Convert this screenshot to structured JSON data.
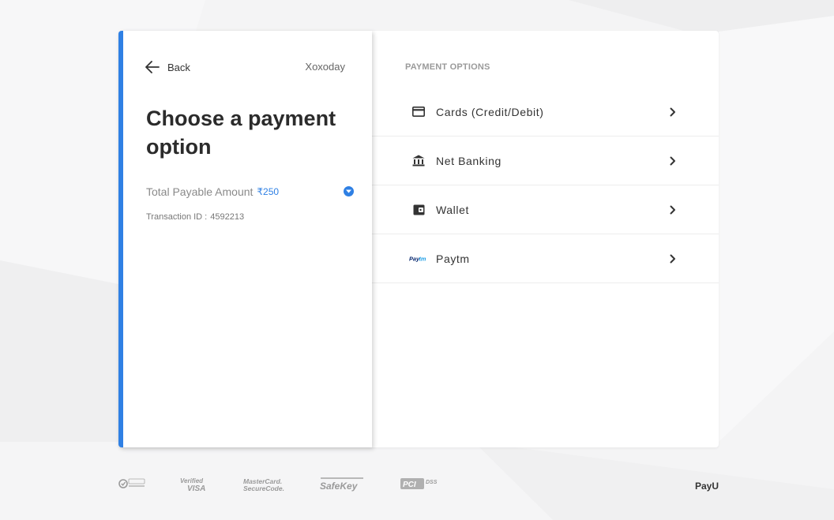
{
  "header": {
    "back_label": "Back",
    "merchant": "Xoxoday"
  },
  "summary": {
    "title": "Choose a payment option",
    "amount_label": "Total Payable Amount",
    "amount_value": "₹250",
    "transaction_label": "Transaction ID :",
    "transaction_id": "4592213"
  },
  "payment_options": {
    "heading": "PAYMENT OPTIONS",
    "items": [
      {
        "label": "Cards (Credit/Debit)",
        "icon": "credit-card-icon"
      },
      {
        "label": "Net Banking",
        "icon": "bank-icon"
      },
      {
        "label": "Wallet",
        "icon": "wallet-icon"
      },
      {
        "label": "Paytm",
        "icon": "paytm-logo"
      }
    ]
  },
  "footer": {
    "badges": [
      "Norton Secured",
      "Verified by VISA",
      "MasterCard SecureCode",
      "American Express SafeKey",
      "PCI DSS"
    ],
    "provider": "PayU"
  },
  "colors": {
    "accent": "#2f80e4",
    "text_dark": "#2b2b2b",
    "text_muted": "#8a8a8a"
  }
}
